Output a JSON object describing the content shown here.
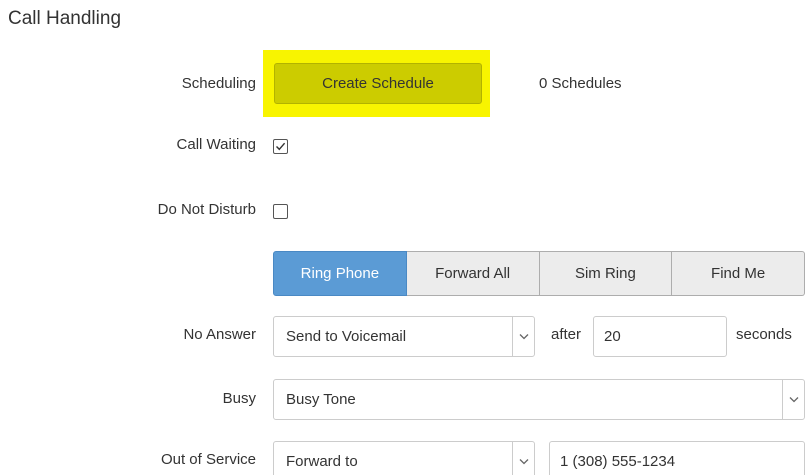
{
  "section": {
    "title": "Call Handling"
  },
  "scheduling": {
    "label": "Scheduling",
    "button_label": "Create Schedule",
    "count_text": "0 Schedules",
    "highlight_color": "#f8f400",
    "button_color": "#cccc00"
  },
  "call_waiting": {
    "label": "Call Waiting",
    "checked": true
  },
  "do_not_disturb": {
    "label": "Do Not Disturb",
    "checked": false
  },
  "mode_tabs": {
    "items": [
      {
        "label": "Ring Phone",
        "active": true
      },
      {
        "label": "Forward All",
        "active": false
      },
      {
        "label": "Sim Ring",
        "active": false
      },
      {
        "label": "Find Me",
        "active": false
      }
    ],
    "active_color": "#5b9bd5"
  },
  "no_answer": {
    "label": "No Answer",
    "selected": "Send to Voicemail",
    "after_label": "after",
    "timeout_value": "20",
    "seconds_label": "seconds"
  },
  "busy": {
    "label": "Busy",
    "selected": "Busy Tone"
  },
  "out_of_service": {
    "label": "Out of Service",
    "selected": "Forward to",
    "forward_number": "1 (308) 555-1234"
  },
  "icons": {
    "checkbox_check": "checkmark-icon",
    "select_caret": "chevron-down-icon"
  }
}
